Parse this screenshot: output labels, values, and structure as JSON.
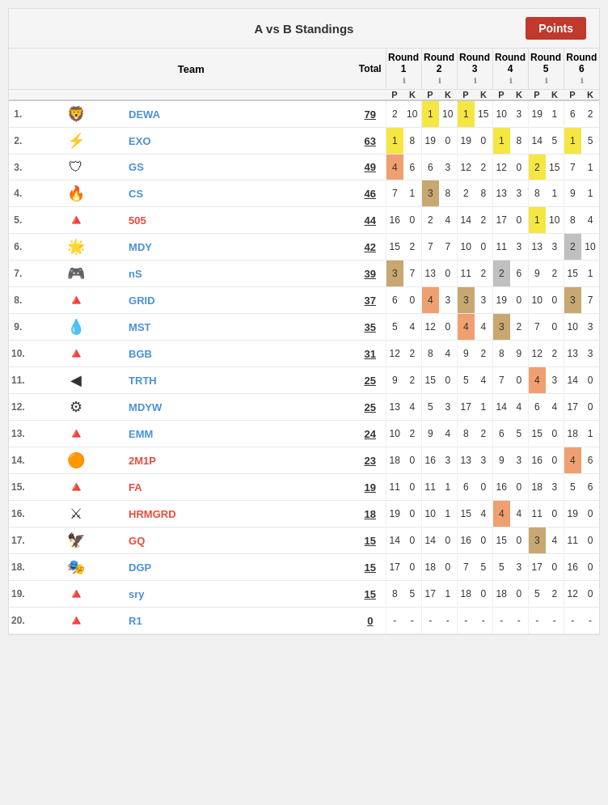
{
  "title": "A vs B Standings",
  "points_button": "Points",
  "columns": {
    "team": "Team",
    "total": "Total"
  },
  "rounds": [
    {
      "label": "Round 1"
    },
    {
      "label": "Round 2"
    },
    {
      "label": "Round 3"
    },
    {
      "label": "Round 4"
    },
    {
      "label": "Round 5"
    },
    {
      "label": "Round 6"
    }
  ],
  "pk_labels": [
    "P",
    "K"
  ],
  "teams": [
    {
      "rank": 1,
      "logo": "DU",
      "name": "DEWA",
      "color": "blue",
      "total": 79,
      "r1p": 2,
      "r1k": 10,
      "r2p": 1,
      "r2k": 10,
      "r3p": 1,
      "r3k": 15,
      "r4p": 10,
      "r4k": 3,
      "r5p": 19,
      "r5k": 1,
      "r6p": 6,
      "r6k": 2,
      "r2p_hl": "gold",
      "r3p_hl": "gold"
    },
    {
      "rank": 2,
      "logo": "EXO",
      "name": "EXO",
      "color": "blue",
      "total": 63,
      "r1p": 1,
      "r1k": 8,
      "r2p": 19,
      "r2k": 0,
      "r3p": 19,
      "r3k": 0,
      "r4p": 1,
      "r4k": 8,
      "r5p": 14,
      "r5k": 5,
      "r6p": 1,
      "r6k": 5,
      "r1p_hl": "gold",
      "r4p_hl": "gold",
      "r6p_hl": "gold"
    },
    {
      "rank": 3,
      "logo": "GS",
      "name": "GS",
      "color": "blue",
      "total": 49,
      "r1p": 4,
      "r1k": 6,
      "r2p": 6,
      "r2k": 3,
      "r3p": 12,
      "r3k": 2,
      "r4p": 12,
      "r4k": 0,
      "r5p": 2,
      "r5k": 15,
      "r6p": 7,
      "r6k": 1,
      "r1p_hl": "orange",
      "r5p_hl": "gold"
    },
    {
      "rank": 4,
      "logo": "CS",
      "name": "CS",
      "color": "blue",
      "total": 46,
      "r1p": 7,
      "r1k": 1,
      "r2p": 3,
      "r2k": 8,
      "r3p": 2,
      "r3k": 8,
      "r4p": 13,
      "r4k": 3,
      "r5p": 8,
      "r5k": 1,
      "r6p": 9,
      "r6k": 1,
      "r2p_hl": "tan"
    },
    {
      "rank": 5,
      "logo": "505",
      "name": "505",
      "color": "red",
      "total": 44,
      "r1p": 16,
      "r1k": 0,
      "r2p": 2,
      "r2k": 4,
      "r3p": 14,
      "r3k": 2,
      "r4p": 17,
      "r4k": 0,
      "r5p": 1,
      "r5k": 10,
      "r6p": 8,
      "r6k": 4,
      "r5p_hl": "gold"
    },
    {
      "rank": 6,
      "logo": "MDY",
      "name": "MDY",
      "color": "blue",
      "total": 42,
      "r1p": 15,
      "r1k": 2,
      "r2p": 7,
      "r2k": 7,
      "r3p": 10,
      "r3k": 0,
      "r4p": 11,
      "r4k": 3,
      "r5p": 13,
      "r5k": 3,
      "r6p": 2,
      "r6k": 10,
      "r6p_hl": "gray"
    },
    {
      "rank": 7,
      "logo": "nS",
      "name": "nS",
      "color": "blue",
      "total": 39,
      "r1p": 3,
      "r1k": 7,
      "r2p": 13,
      "r2k": 0,
      "r3p": 11,
      "r3k": 2,
      "r4p": 2,
      "r4k": 6,
      "r5p": 9,
      "r5k": 2,
      "r6p": 15,
      "r6k": 1,
      "r1p_hl": "tan",
      "r4p_hl": "gray"
    },
    {
      "rank": 8,
      "logo": "GRD",
      "name": "GRID",
      "color": "blue",
      "total": 37,
      "r1p": 6,
      "r1k": 0,
      "r2p": 4,
      "r2k": 3,
      "r3p": 3,
      "r3k": 3,
      "r4p": 19,
      "r4k": 0,
      "r5p": 10,
      "r5k": 0,
      "r6p": 3,
      "r6k": 7,
      "r2p_hl": "orange",
      "r3p_hl": "tan",
      "r6p_hl": "tan"
    },
    {
      "rank": 9,
      "logo": "MST",
      "name": "MST",
      "color": "blue",
      "total": 35,
      "r1p": 5,
      "r1k": 4,
      "r2p": 12,
      "r2k": 0,
      "r3p": 4,
      "r3k": 4,
      "r4p": 3,
      "r4k": 2,
      "r5p": 7,
      "r5k": 0,
      "r6p": 10,
      "r6k": 3,
      "r3p_hl": "orange",
      "r4p_hl": "tan"
    },
    {
      "rank": 10,
      "logo": "BGB",
      "name": "BGB",
      "color": "blue",
      "total": 31,
      "r1p": 12,
      "r1k": 2,
      "r2p": 8,
      "r2k": 4,
      "r3p": 9,
      "r3k": 2,
      "r4p": 8,
      "r4k": 9,
      "r5p": 12,
      "r5k": 2,
      "r6p": 13,
      "r6k": 3
    },
    {
      "rank": 11,
      "logo": "TRT",
      "name": "TRTH",
      "color": "blue",
      "total": 25,
      "r1p": 9,
      "r1k": 2,
      "r2p": 15,
      "r2k": 0,
      "r3p": 5,
      "r3k": 4,
      "r4p": 7,
      "r4k": 0,
      "r5p": 4,
      "r5k": 3,
      "r6p": 14,
      "r6k": 0,
      "r5p_hl": "orange"
    },
    {
      "rank": 12,
      "logo": "MDW",
      "name": "MDYW",
      "color": "blue",
      "total": 25,
      "r1p": 13,
      "r1k": 4,
      "r2p": 5,
      "r2k": 3,
      "r3p": 17,
      "r3k": 1,
      "r4p": 14,
      "r4k": 4,
      "r5p": 6,
      "r5k": 4,
      "r6p": 17,
      "r6k": 0
    },
    {
      "rank": 13,
      "logo": "EMM",
      "name": "EMM",
      "color": "blue",
      "total": 24,
      "r1p": 10,
      "r1k": 2,
      "r2p": 9,
      "r2k": 4,
      "r3p": 8,
      "r3k": 2,
      "r4p": 6,
      "r4k": 5,
      "r5p": 15,
      "r5k": 0,
      "r6p": 18,
      "r6k": 1
    },
    {
      "rank": 14,
      "logo": "2M",
      "name": "2M1P",
      "color": "red",
      "total": 23,
      "r1p": 18,
      "r1k": 0,
      "r2p": 16,
      "r2k": 3,
      "r3p": 13,
      "r3k": 3,
      "r4p": 9,
      "r4k": 3,
      "r5p": 16,
      "r5k": 0,
      "r6p": 4,
      "r6k": 6,
      "r6p_hl": "orange"
    },
    {
      "rank": 15,
      "logo": "FA",
      "name": "FA",
      "color": "red",
      "total": 19,
      "r1p": 11,
      "r1k": 0,
      "r2p": 11,
      "r2k": 1,
      "r3p": 6,
      "r3k": 0,
      "r4p": 16,
      "r4k": 0,
      "r5p": 18,
      "r5k": 3,
      "r6p": 5,
      "r6k": 6
    },
    {
      "rank": 16,
      "logo": "HRM",
      "name": "HRMGRD",
      "color": "red",
      "total": 18,
      "r1p": 19,
      "r1k": 0,
      "r2p": 10,
      "r2k": 1,
      "r3p": 15,
      "r3k": 4,
      "r4p": 4,
      "r4k": 4,
      "r5p": 11,
      "r5k": 0,
      "r6p": 19,
      "r6k": 0,
      "r4p_hl": "orange"
    },
    {
      "rank": 17,
      "logo": "GQ",
      "name": "GQ",
      "color": "red",
      "total": 15,
      "r1p": 14,
      "r1k": 0,
      "r2p": 14,
      "r2k": 0,
      "r3p": 16,
      "r3k": 0,
      "r4p": 15,
      "r4k": 0,
      "r5p": 3,
      "r5k": 4,
      "r6p": 11,
      "r6k": 0,
      "r5p_hl": "tan"
    },
    {
      "rank": 18,
      "logo": "DGP",
      "name": "DGP",
      "color": "blue",
      "total": 15,
      "r1p": 17,
      "r1k": 0,
      "r2p": 18,
      "r2k": 0,
      "r3p": 7,
      "r3k": 5,
      "r4p": 5,
      "r4k": 3,
      "r5p": 17,
      "r5k": 0,
      "r6p": 16,
      "r6k": 0
    },
    {
      "rank": 19,
      "logo": "sry",
      "name": "sry",
      "color": "blue",
      "total": 15,
      "r1p": 8,
      "r1k": 5,
      "r2p": 17,
      "r2k": 1,
      "r3p": 18,
      "r3k": 0,
      "r4p": 18,
      "r4k": 0,
      "r5p": 5,
      "r5k": 2,
      "r6p": 12,
      "r6k": 0
    },
    {
      "rank": 20,
      "logo": "R1",
      "name": "R1",
      "color": "blue",
      "total": 0,
      "r1p": "-",
      "r1k": "-",
      "r2p": "-",
      "r2k": "-",
      "r3p": "-",
      "r3k": "-",
      "r4p": "-",
      "r4k": "-",
      "r5p": "-",
      "r5k": "-",
      "r6p": "-",
      "r6k": "-"
    }
  ]
}
